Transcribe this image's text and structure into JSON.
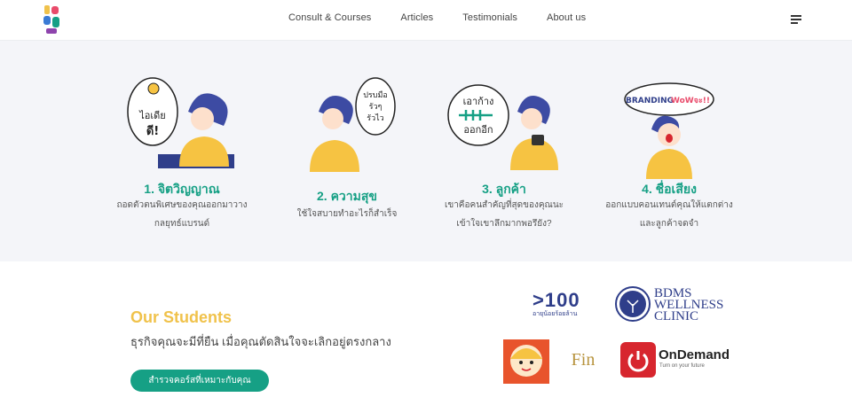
{
  "nav": {
    "logo_alt": "ชุ่มรา",
    "menu": [
      "Consult & Courses",
      "Articles",
      "Testimonials",
      "About us"
    ],
    "menu_icon": "hamburger-icon"
  },
  "values": [
    {
      "title": "1. จิตวิญญาณ",
      "desc_lines": [
        "ถอดตัวตนพิเศษของคุณออกมาวาง",
        "กลยุทธ์แบรนด์"
      ],
      "bubble": [
        "ไอเดีย",
        "ดี!"
      ]
    },
    {
      "title": "2. ความสุข",
      "desc_lines": [
        "ใช้ใจสบายทำอะไรก็สำเร็จ"
      ],
      "bubble": [
        "ปรบมือ",
        "รัวๆ",
        "รัวไว"
      ]
    },
    {
      "title": "3. ลูกค้า",
      "desc_lines": [
        "เขาคือคนสำคัญที่สุดของคุณนะ",
        "เข้าใจเขาลึกมากพอรึยัง?"
      ],
      "bubble": [
        "เอาก้าง",
        "ออกอีก"
      ]
    },
    {
      "title": "4. ชื่อเสียง",
      "desc_lines": [
        "ออกแบบคอนเทนต์คุณให้แตกต่าง",
        "และลูกค้าจดจำ"
      ],
      "bubble": [
        "BRANDING",
        "WoWจะ!!"
      ]
    }
  ],
  "students": {
    "title": "Our Students",
    "subtitle": "ธุรกิจคุณจะมีที่ยืน เมื่อคุณตัดสินใจจะเลิกอยู่ตรงกลาง",
    "cta": "สำรวจคอร์สที่เหมาะกับคุณ"
  },
  "partners": {
    "p100": {
      "mark": ">100",
      "sub": "อายุน้อยร้อยล้าน"
    },
    "bdms": {
      "line1": "BDMS",
      "line2": "WELLNESS",
      "line3": "CLINIC"
    },
    "fin": "Fin",
    "ondemand": {
      "name": "OnDemand",
      "tag": "Turn on your future"
    }
  },
  "colors": {
    "accent": "#16a085",
    "title_yellow": "#f0c24b",
    "navy": "#2f3e8a",
    "sweater": "#f6c342",
    "red": "#d7262e"
  }
}
